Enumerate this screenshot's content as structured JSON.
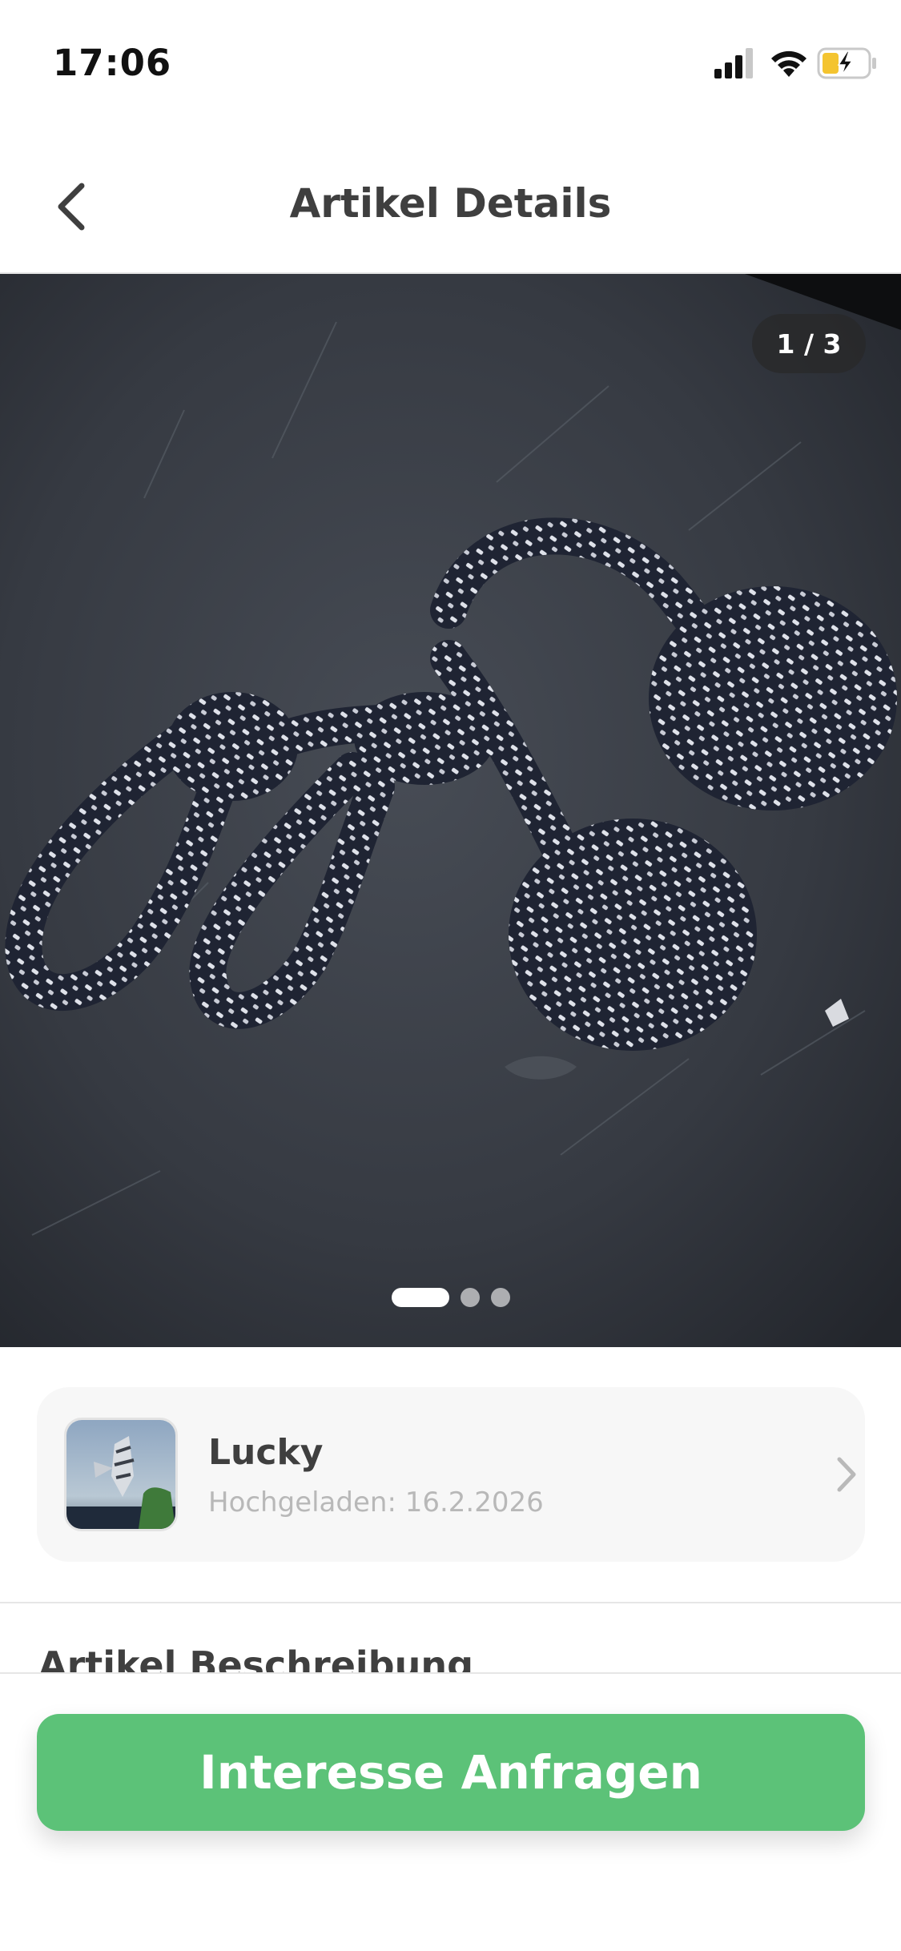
{
  "status_bar": {
    "time": "17:06"
  },
  "nav": {
    "title": "Artikel Details"
  },
  "carousel": {
    "counter": "1 / 3",
    "total_images": 3,
    "active_index": 0
  },
  "uploader": {
    "name": "Lucky",
    "uploaded": "Hochgeladen: 16.2.2026"
  },
  "description": {
    "section_title": "Artikel Beschreibung"
  },
  "cta": {
    "label": "Interesse Anfragen"
  },
  "colors": {
    "accent": "#5cc278",
    "title_text": "#3f3f3f",
    "muted_text": "#b8b8b8",
    "card_bg": "#f7f7f7"
  },
  "icons": [
    "signal-icon",
    "wifi-icon",
    "battery-charging-icon",
    "back-chevron-icon",
    "chevron-right-icon"
  ]
}
